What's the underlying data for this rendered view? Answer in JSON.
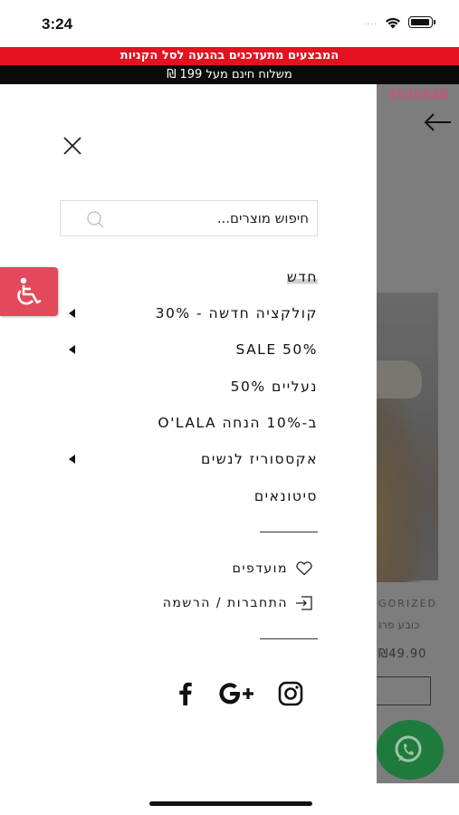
{
  "status_bar": {
    "time": "3:24",
    "signal": "....",
    "icons": [
      "wifi-icon",
      "battery-icon"
    ]
  },
  "banners": {
    "promo": "המבצעים מתעדכנים בהגעה לסל הקניות",
    "shipping": "משלוח חינם מעל 199 ₪"
  },
  "background_page": {
    "phone": "-3935848",
    "category": "GORIZED",
    "product_name": "כובע פרו",
    "price": "₪49.90"
  },
  "drawer": {
    "search": {
      "placeholder": "חיפוש מוצרים..."
    },
    "menu_items": [
      {
        "label": "חדש",
        "has_submenu": false,
        "highlighted": true
      },
      {
        "label": "קולקציה חדשה - 30%",
        "has_submenu": true
      },
      {
        "label": "SALE 50%",
        "has_submenu": true
      },
      {
        "label": "נעליים 50%",
        "has_submenu": false
      },
      {
        "label": "O'LALA ב-10% הנחה",
        "has_submenu": false
      },
      {
        "label": "אקססוריז לנשים",
        "has_submenu": true
      },
      {
        "label": "סיטונאים",
        "has_submenu": false
      }
    ],
    "account_links": {
      "wishlist": "מועדפים",
      "login": "התחברות / הרשמה"
    },
    "social": [
      "facebook-icon",
      "google-plus-icon",
      "instagram-icon"
    ]
  },
  "colors": {
    "promo_banner": "#e4121e",
    "shipping_banner": "#0b0b0b",
    "accessibility": "#e2495b",
    "whatsapp": "#1f7a3e",
    "overlay": "#7d7d7d"
  }
}
